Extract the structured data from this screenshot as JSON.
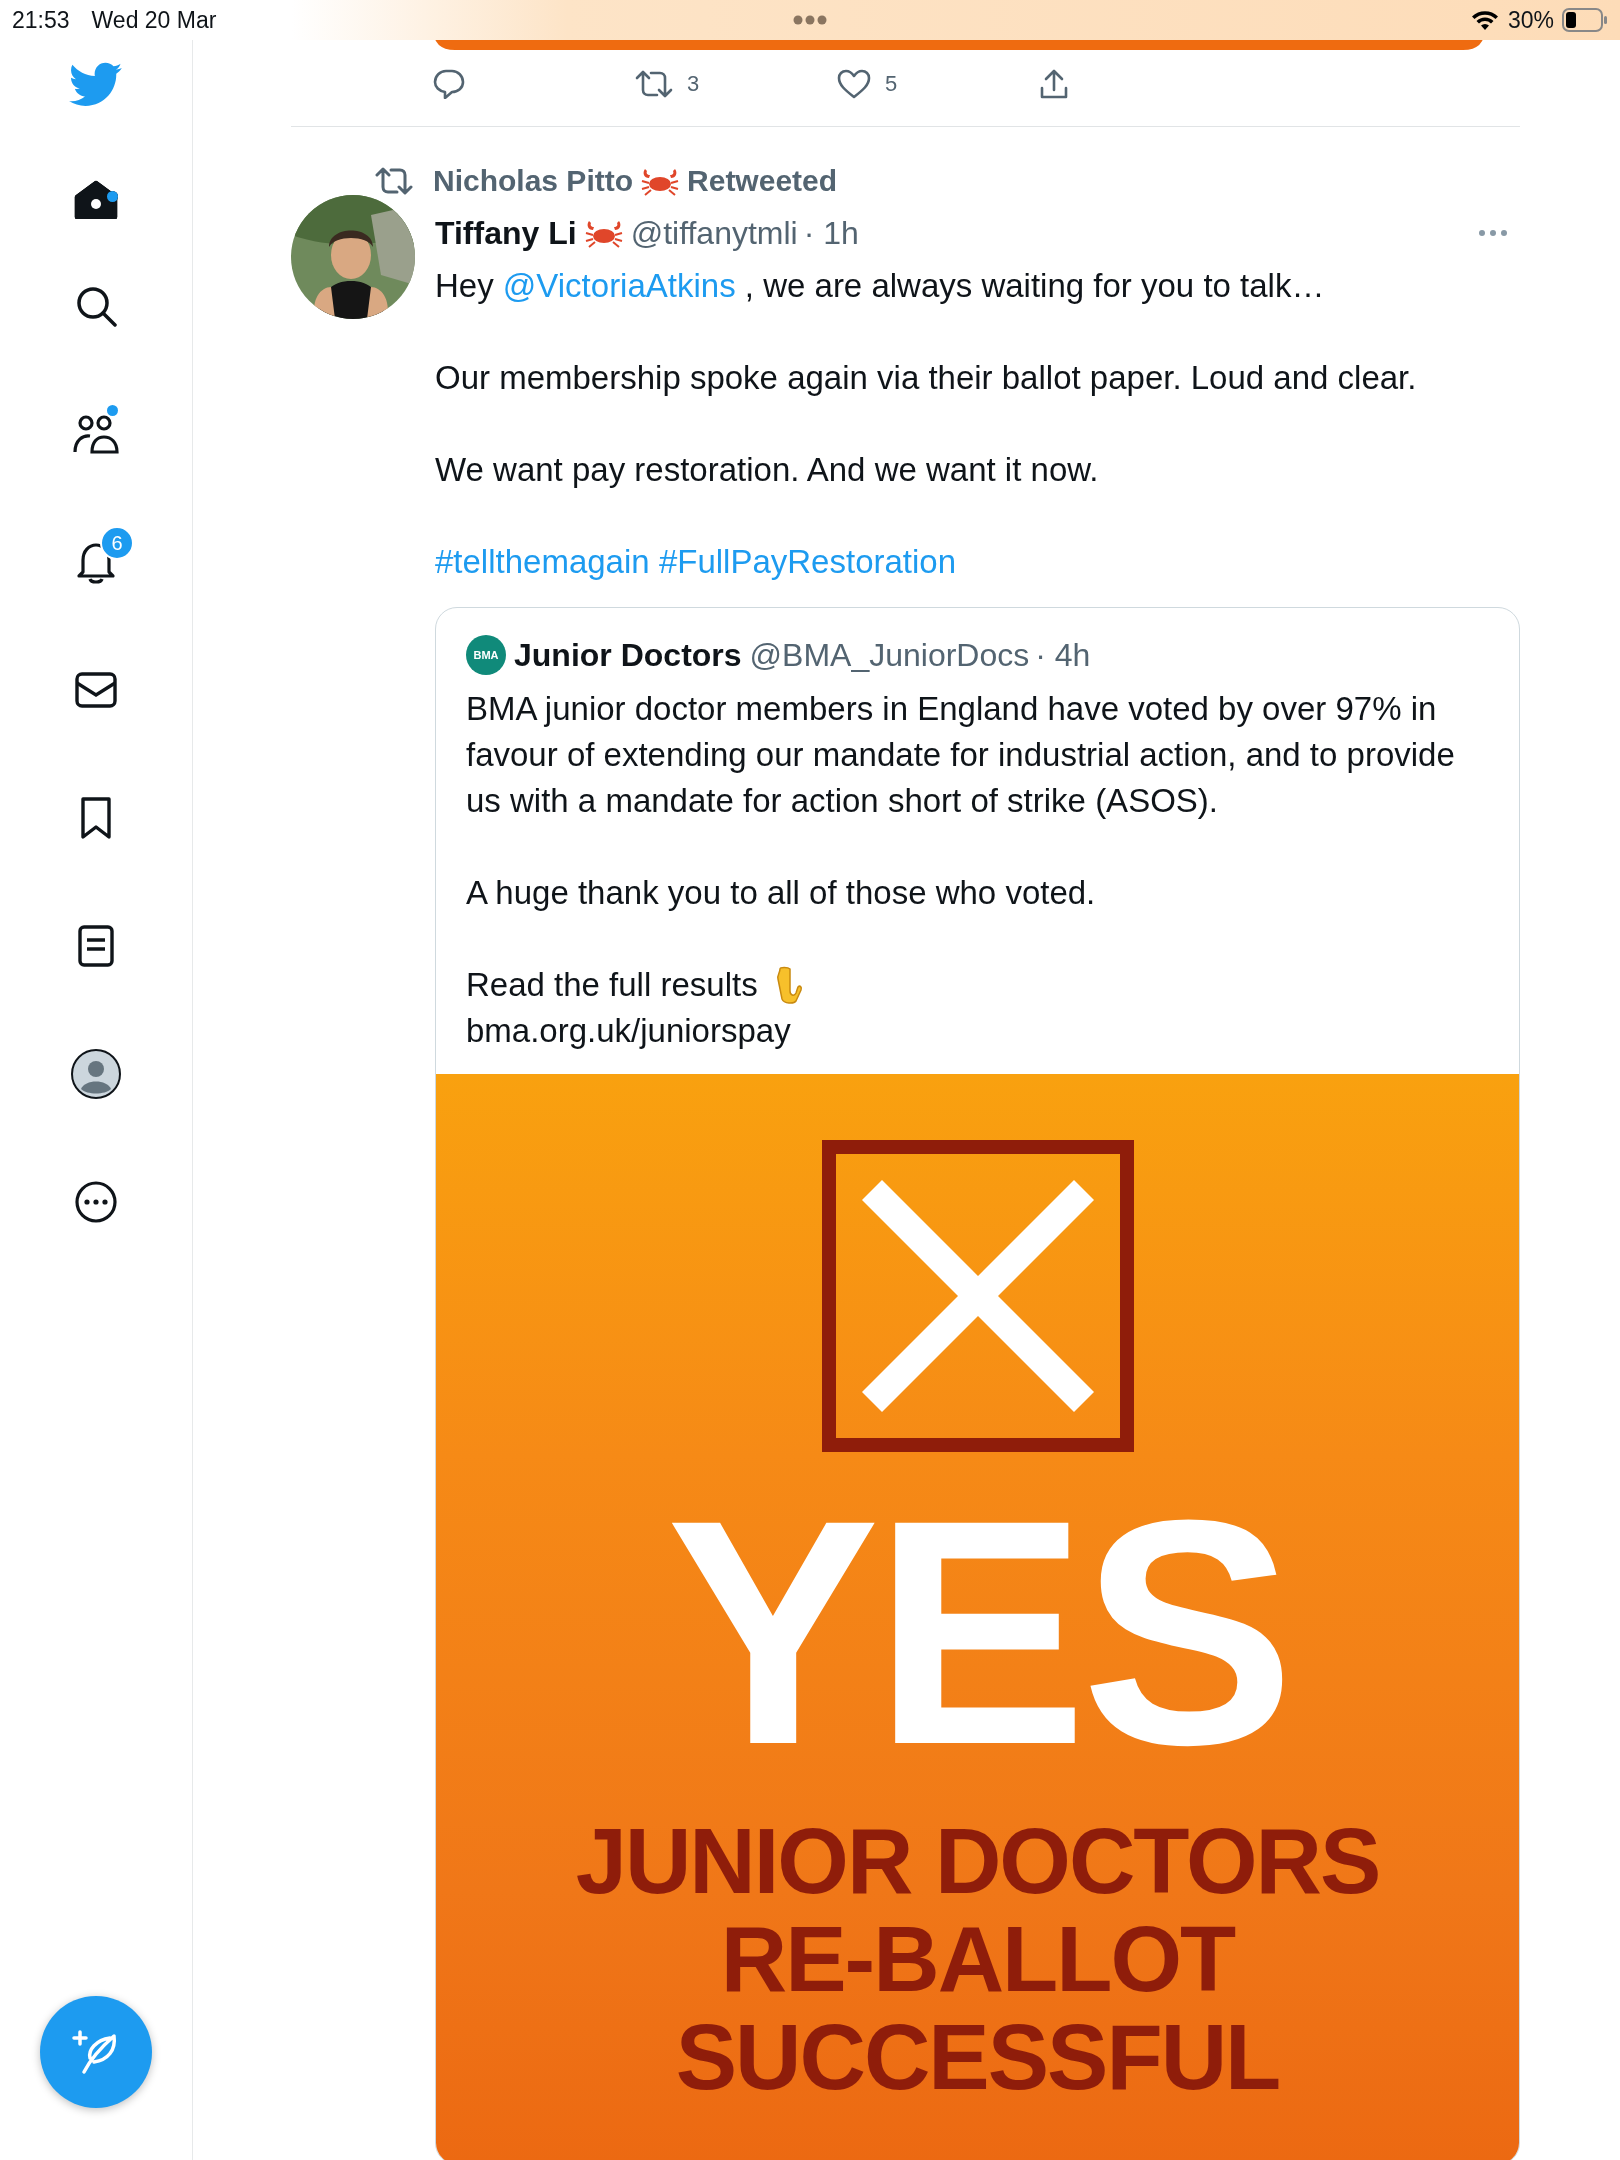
{
  "status_bar": {
    "time": "21:53",
    "date": "Wed 20 Mar",
    "battery": "30%"
  },
  "sidebar": {
    "items": [
      {
        "kind": "home",
        "selected": true,
        "unread": true
      },
      {
        "kind": "search",
        "selected": false,
        "unread": false
      },
      {
        "kind": "communities",
        "selected": false,
        "unread": true
      },
      {
        "kind": "notifications",
        "selected": false,
        "badge": "6"
      },
      {
        "kind": "messages",
        "selected": false,
        "unread": false
      },
      {
        "kind": "bookmarks",
        "selected": false,
        "unread": false
      },
      {
        "kind": "lists",
        "selected": false,
        "unread": false
      },
      {
        "kind": "profile",
        "selected": false,
        "unread": false
      },
      {
        "kind": "more",
        "selected": false,
        "unread": false
      }
    ]
  },
  "previous_tweet": {
    "actions": [
      {
        "kind": "reply"
      },
      {
        "kind": "retweet",
        "count": "3"
      },
      {
        "kind": "like",
        "count": "5"
      },
      {
        "kind": "share"
      }
    ]
  },
  "tweet": {
    "retweeted_by": "Nicholas Pitto",
    "retweet_label": "Retweeted",
    "author": "Tiffany Li",
    "handle": "@tiffanytmli",
    "time": "· 1h",
    "paragraphs": [
      [
        {
          "kind": "plain",
          "text": "Hey "
        },
        {
          "kind": "link",
          "text": "@VictoriaAtkins"
        },
        {
          "kind": "plain",
          "text": " , we are always waiting for you to talk…"
        }
      ],
      [
        {
          "kind": "plain",
          "text": "Our membership spoke again via their ballot paper. Loud and clear."
        }
      ],
      [
        {
          "kind": "plain",
          "text": "We want pay restoration. And we want it now."
        }
      ],
      [
        {
          "kind": "link",
          "text": "#tellthemagain"
        },
        {
          "kind": "link",
          "text": "#FullPayRestoration"
        }
      ]
    ],
    "quote": {
      "logo": "BMA",
      "author": "Junior Doctors",
      "handle": "@BMA_JuniorDocs",
      "time": "· 4h",
      "paragraphs": [
        "BMA junior doctor members in England have voted by over 97% in favour of extending our mandate for industrial action, and to provide us with a mandate for action short of strike (ASOS).",
        "A huge thank you to all of those who voted."
      ],
      "cta": "Read the full results",
      "url": "bma.org.uk/juniorspay",
      "media": {
        "headline": "YES",
        "lines": [
          "JUNIOR DOCTORS",
          "RE-BALLOT",
          "SUCCESSFUL"
        ]
      }
    }
  }
}
